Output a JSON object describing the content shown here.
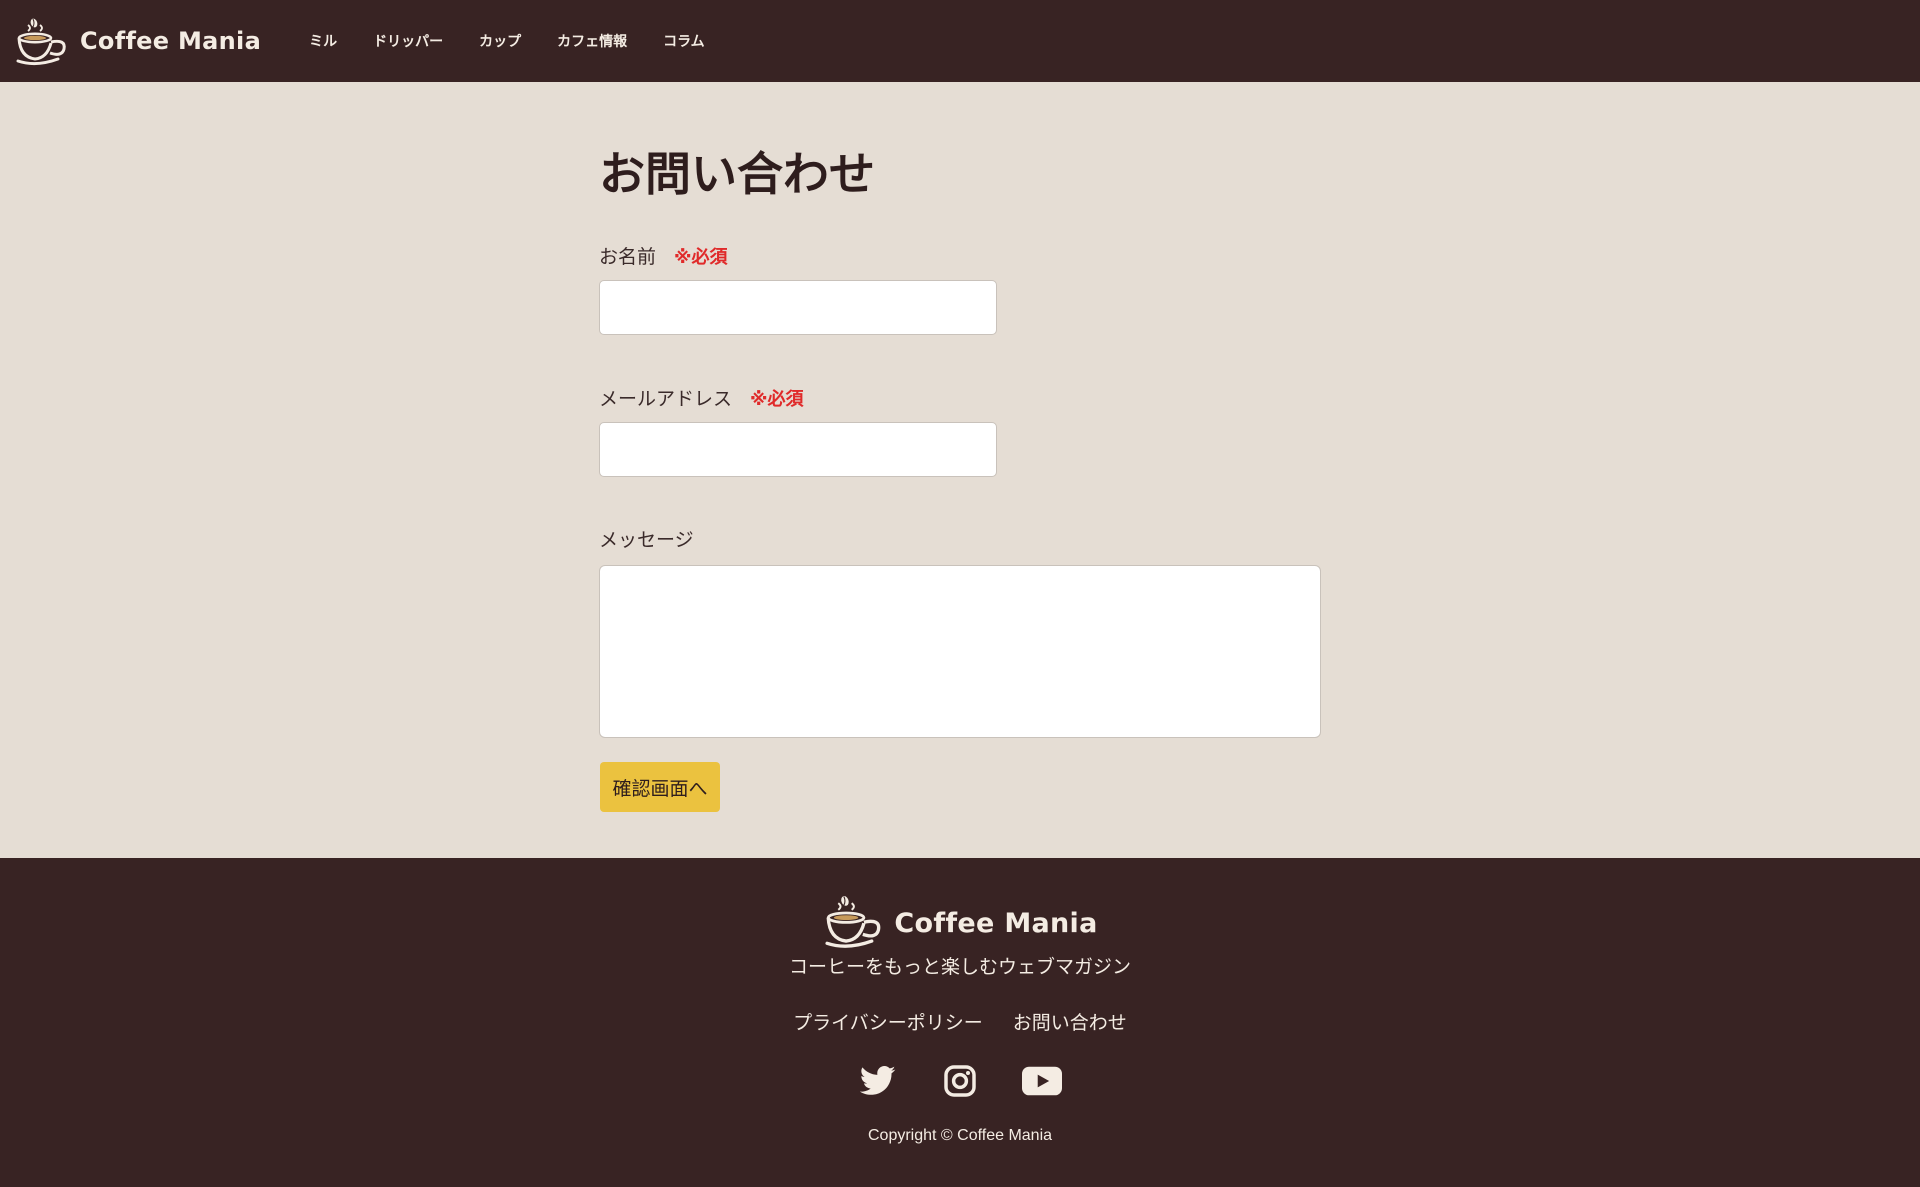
{
  "header": {
    "logo_text": "Coffee Mania",
    "nav": [
      {
        "label": "ミル"
      },
      {
        "label": "ドリッパー"
      },
      {
        "label": "カップ"
      },
      {
        "label": "カフェ情報"
      },
      {
        "label": "コラム"
      }
    ]
  },
  "main": {
    "title": "お問い合わせ",
    "fields": {
      "name": {
        "label": "お名前",
        "required": "※必須",
        "value": "",
        "placeholder": ""
      },
      "email": {
        "label": "メールアドレス",
        "required": "※必須",
        "value": "",
        "placeholder": ""
      },
      "message": {
        "label": "メッセージ",
        "value": "",
        "placeholder": ""
      }
    },
    "submit_label": "確認画面へ"
  },
  "footer": {
    "logo_text": "Coffee Mania",
    "tagline": "コーヒーをもっと楽しむウェブマガジン",
    "links": [
      {
        "label": "プライバシーポリシー"
      },
      {
        "label": "お問い合わせ"
      }
    ],
    "social": [
      "twitter-icon",
      "instagram-icon",
      "youtube-icon"
    ],
    "copyright": "Copyright © Coffee Mania"
  },
  "colors": {
    "header_bg": "#382323",
    "page_bg": "#e5ddd4",
    "accent": "#ebc23f",
    "required": "#e02a2a",
    "text_light": "#f4ece3"
  }
}
